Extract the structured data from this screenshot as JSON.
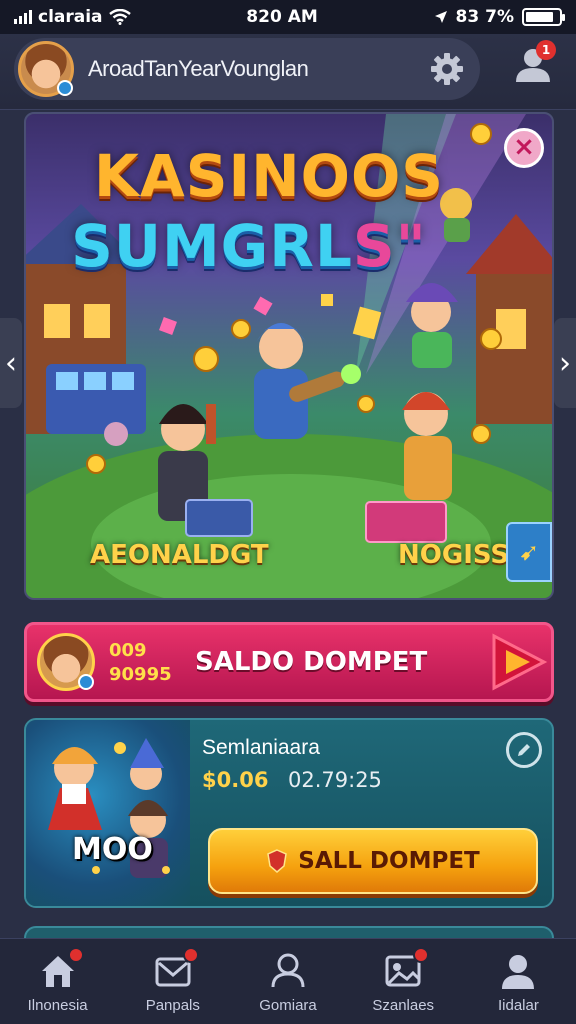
{
  "status_bar": {
    "carrier": "claraia",
    "time": "820 AM",
    "battery_text": "83 7%",
    "battery_level": 0.85
  },
  "header": {
    "profile_name": "AroadTanYearVounglan",
    "notification_count": "1"
  },
  "hero": {
    "title_line1": "KASINOOS",
    "title_line2_main": "SUMGRL",
    "title_line2_accent": "S\"",
    "label_left": "AEONALDGT",
    "label_right": "NOGISS"
  },
  "saldo": {
    "num_line1": "009",
    "num_line2": "90995",
    "label": "SALDO DOMPET"
  },
  "promo": {
    "art_label": "MOO",
    "title": "Semlaniaara",
    "amount": "$0.06",
    "time": "02.79:25",
    "cta_label": "SALL DOMPET"
  },
  "bottom_nav": {
    "items": [
      {
        "label": "Ilnonesia",
        "icon": "home-icon"
      },
      {
        "label": "Panpals",
        "icon": "mail-icon"
      },
      {
        "label": "Gomiara",
        "icon": "person-icon"
      },
      {
        "label": "Szanlaes",
        "icon": "gallery-icon"
      },
      {
        "label": "Iidalar",
        "icon": "profile-icon"
      }
    ]
  },
  "colors": {
    "accent_pink": "#e8326a",
    "accent_gold": "#ffd24a",
    "background": "#2a2f45",
    "card_teal": "#1f6878"
  }
}
